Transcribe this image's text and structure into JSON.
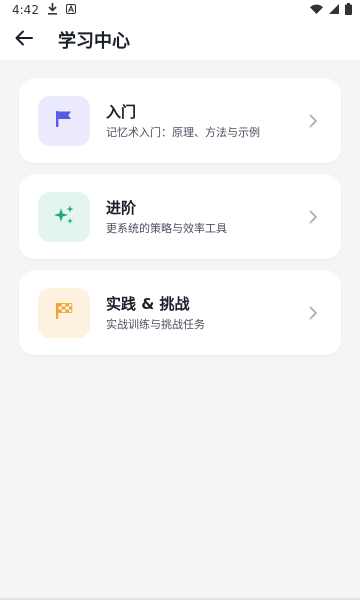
{
  "status_bar": {
    "time": "4:42",
    "icons": [
      "download-icon",
      "app-a-icon",
      "wifi-icon",
      "signal-icon",
      "battery-icon"
    ]
  },
  "header": {
    "back_icon": "arrow-left-icon",
    "title": "学习中心"
  },
  "cards": [
    {
      "title": "入门",
      "subtitle": "记忆术入门：原理、方法与示例",
      "icon": "flag-icon",
      "tile_color": "#ebeafd",
      "icon_color": "#5b57e6"
    },
    {
      "title": "进阶",
      "subtitle": "更系统的策略与效率工具",
      "icon": "sparkles-icon",
      "tile_color": "#e3f5ee",
      "icon_color": "#1bab6f"
    },
    {
      "title": "实践 & 挑战",
      "subtitle": "实战训练与挑战任务",
      "icon": "checkered-flag-icon",
      "tile_color": "#fdf1e0",
      "icon_color": "#f0a23a"
    }
  ],
  "colors": {
    "background": "#f4f5f7",
    "card": "#ffffff",
    "chevron": "#a9adb6"
  }
}
